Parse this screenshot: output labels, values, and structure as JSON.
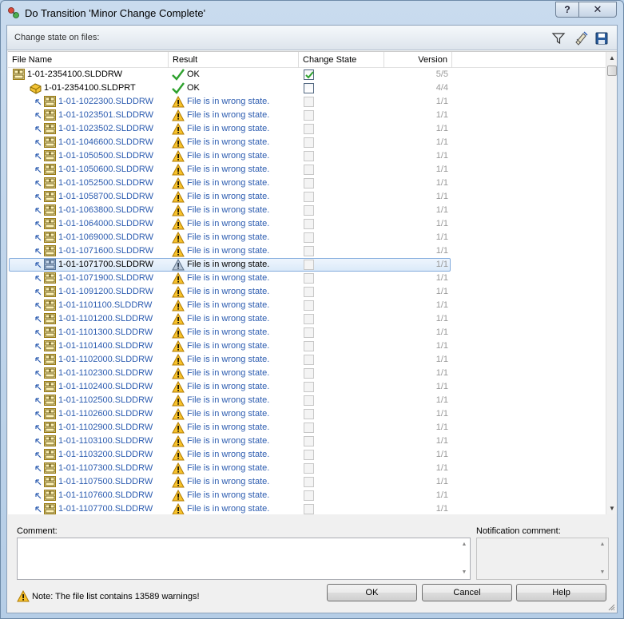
{
  "window": {
    "title": "Do Transition 'Minor Change Complete'",
    "help_label": "?",
    "close_label": "✕"
  },
  "toolbar": {
    "label": "Change state on files:",
    "icons": [
      "filter-icon",
      "warning-hide-icon",
      "save-icon"
    ]
  },
  "grid": {
    "columns": [
      "File Name",
      "Result",
      "Change State",
      "Version"
    ],
    "rows": [
      {
        "file": "1-01-2354100.SLDDRW",
        "type": "drawing",
        "indent": 0,
        "result": "OK",
        "status": "ok",
        "checked": true,
        "enabled": true,
        "version": "5/5"
      },
      {
        "file": "1-01-2354100.SLDPRT",
        "type": "part",
        "indent": 1,
        "result": "OK",
        "status": "ok",
        "checked": false,
        "enabled": true,
        "version": "4/4"
      },
      {
        "file": "1-01-1022300.SLDDRW",
        "type": "drawing",
        "indent": 2,
        "result": "File is in wrong state.",
        "status": "warning",
        "checked": false,
        "enabled": false,
        "version": "1/1"
      },
      {
        "file": "1-01-1023501.SLDDRW",
        "type": "drawing",
        "indent": 2,
        "result": "File is in wrong state.",
        "status": "warning",
        "checked": false,
        "enabled": false,
        "version": "1/1"
      },
      {
        "file": "1-01-1023502.SLDDRW",
        "type": "drawing",
        "indent": 2,
        "result": "File is in wrong state.",
        "status": "warning",
        "checked": false,
        "enabled": false,
        "version": "1/1"
      },
      {
        "file": "1-01-1046600.SLDDRW",
        "type": "drawing",
        "indent": 2,
        "result": "File is in wrong state.",
        "status": "warning",
        "checked": false,
        "enabled": false,
        "version": "1/1"
      },
      {
        "file": "1-01-1050500.SLDDRW",
        "type": "drawing",
        "indent": 2,
        "result": "File is in wrong state.",
        "status": "warning",
        "checked": false,
        "enabled": false,
        "version": "1/1"
      },
      {
        "file": "1-01-1050600.SLDDRW",
        "type": "drawing",
        "indent": 2,
        "result": "File is in wrong state.",
        "status": "warning",
        "checked": false,
        "enabled": false,
        "version": "1/1"
      },
      {
        "file": "1-01-1052500.SLDDRW",
        "type": "drawing",
        "indent": 2,
        "result": "File is in wrong state.",
        "status": "warning",
        "checked": false,
        "enabled": false,
        "version": "1/1"
      },
      {
        "file": "1-01-1058700.SLDDRW",
        "type": "drawing",
        "indent": 2,
        "result": "File is in wrong state.",
        "status": "warning",
        "checked": false,
        "enabled": false,
        "version": "1/1"
      },
      {
        "file": "1-01-1063800.SLDDRW",
        "type": "drawing",
        "indent": 2,
        "result": "File is in wrong state.",
        "status": "warning",
        "checked": false,
        "enabled": false,
        "version": "1/1"
      },
      {
        "file": "1-01-1064000.SLDDRW",
        "type": "drawing",
        "indent": 2,
        "result": "File is in wrong state.",
        "status": "warning",
        "checked": false,
        "enabled": false,
        "version": "1/1"
      },
      {
        "file": "1-01-1069000.SLDDRW",
        "type": "drawing",
        "indent": 2,
        "result": "File is in wrong state.",
        "status": "warning",
        "checked": false,
        "enabled": false,
        "version": "1/1"
      },
      {
        "file": "1-01-1071600.SLDDRW",
        "type": "drawing",
        "indent": 2,
        "result": "File is in wrong state.",
        "status": "warning",
        "checked": false,
        "enabled": false,
        "version": "1/1"
      },
      {
        "file": "1-01-1071700.SLDDRW",
        "type": "drawing",
        "indent": 2,
        "result": "File is in wrong state.",
        "status": "warning",
        "checked": false,
        "enabled": false,
        "version": "1/1",
        "selected": true
      },
      {
        "file": "1-01-1071900.SLDDRW",
        "type": "drawing",
        "indent": 2,
        "result": "File is in wrong state.",
        "status": "warning",
        "checked": false,
        "enabled": false,
        "version": "1/1"
      },
      {
        "file": "1-01-1091200.SLDDRW",
        "type": "drawing",
        "indent": 2,
        "result": "File is in wrong state.",
        "status": "warning",
        "checked": false,
        "enabled": false,
        "version": "1/1"
      },
      {
        "file": "1-01-1101100.SLDDRW",
        "type": "drawing",
        "indent": 2,
        "result": "File is in wrong state.",
        "status": "warning",
        "checked": false,
        "enabled": false,
        "version": "1/1"
      },
      {
        "file": "1-01-1101200.SLDDRW",
        "type": "drawing",
        "indent": 2,
        "result": "File is in wrong state.",
        "status": "warning",
        "checked": false,
        "enabled": false,
        "version": "1/1"
      },
      {
        "file": "1-01-1101300.SLDDRW",
        "type": "drawing",
        "indent": 2,
        "result": "File is in wrong state.",
        "status": "warning",
        "checked": false,
        "enabled": false,
        "version": "1/1"
      },
      {
        "file": "1-01-1101400.SLDDRW",
        "type": "drawing",
        "indent": 2,
        "result": "File is in wrong state.",
        "status": "warning",
        "checked": false,
        "enabled": false,
        "version": "1/1"
      },
      {
        "file": "1-01-1102000.SLDDRW",
        "type": "drawing",
        "indent": 2,
        "result": "File is in wrong state.",
        "status": "warning",
        "checked": false,
        "enabled": false,
        "version": "1/1"
      },
      {
        "file": "1-01-1102300.SLDDRW",
        "type": "drawing",
        "indent": 2,
        "result": "File is in wrong state.",
        "status": "warning",
        "checked": false,
        "enabled": false,
        "version": "1/1"
      },
      {
        "file": "1-01-1102400.SLDDRW",
        "type": "drawing",
        "indent": 2,
        "result": "File is in wrong state.",
        "status": "warning",
        "checked": false,
        "enabled": false,
        "version": "1/1"
      },
      {
        "file": "1-01-1102500.SLDDRW",
        "type": "drawing",
        "indent": 2,
        "result": "File is in wrong state.",
        "status": "warning",
        "checked": false,
        "enabled": false,
        "version": "1/1"
      },
      {
        "file": "1-01-1102600.SLDDRW",
        "type": "drawing",
        "indent": 2,
        "result": "File is in wrong state.",
        "status": "warning",
        "checked": false,
        "enabled": false,
        "version": "1/1"
      },
      {
        "file": "1-01-1102900.SLDDRW",
        "type": "drawing",
        "indent": 2,
        "result": "File is in wrong state.",
        "status": "warning",
        "checked": false,
        "enabled": false,
        "version": "1/1"
      },
      {
        "file": "1-01-1103100.SLDDRW",
        "type": "drawing",
        "indent": 2,
        "result": "File is in wrong state.",
        "status": "warning",
        "checked": false,
        "enabled": false,
        "version": "1/1"
      },
      {
        "file": "1-01-1103200.SLDDRW",
        "type": "drawing",
        "indent": 2,
        "result": "File is in wrong state.",
        "status": "warning",
        "checked": false,
        "enabled": false,
        "version": "1/1"
      },
      {
        "file": "1-01-1107300.SLDDRW",
        "type": "drawing",
        "indent": 2,
        "result": "File is in wrong state.",
        "status": "warning",
        "checked": false,
        "enabled": false,
        "version": "1/1"
      },
      {
        "file": "1-01-1107500.SLDDRW",
        "type": "drawing",
        "indent": 2,
        "result": "File is in wrong state.",
        "status": "warning",
        "checked": false,
        "enabled": false,
        "version": "1/1"
      },
      {
        "file": "1-01-1107600.SLDDRW",
        "type": "drawing",
        "indent": 2,
        "result": "File is in wrong state.",
        "status": "warning",
        "checked": false,
        "enabled": false,
        "version": "1/1"
      },
      {
        "file": "1-01-1107700.SLDDRW",
        "type": "drawing",
        "indent": 2,
        "result": "File is in wrong state.",
        "status": "warning",
        "checked": false,
        "enabled": false,
        "version": "1/1"
      }
    ]
  },
  "comment": {
    "label": "Comment:",
    "value": ""
  },
  "notification": {
    "label": "Notification comment:",
    "value": ""
  },
  "note": {
    "text": "Note: The file list contains 13589 warnings!"
  },
  "buttons": {
    "ok": "OK",
    "cancel": "Cancel",
    "help": "Help"
  },
  "colors": {
    "link_blue": "#2c5cb0",
    "warning_yellow": "#f7c22b",
    "ok_green": "#2ea12e",
    "selection": "#dbeaf9"
  }
}
